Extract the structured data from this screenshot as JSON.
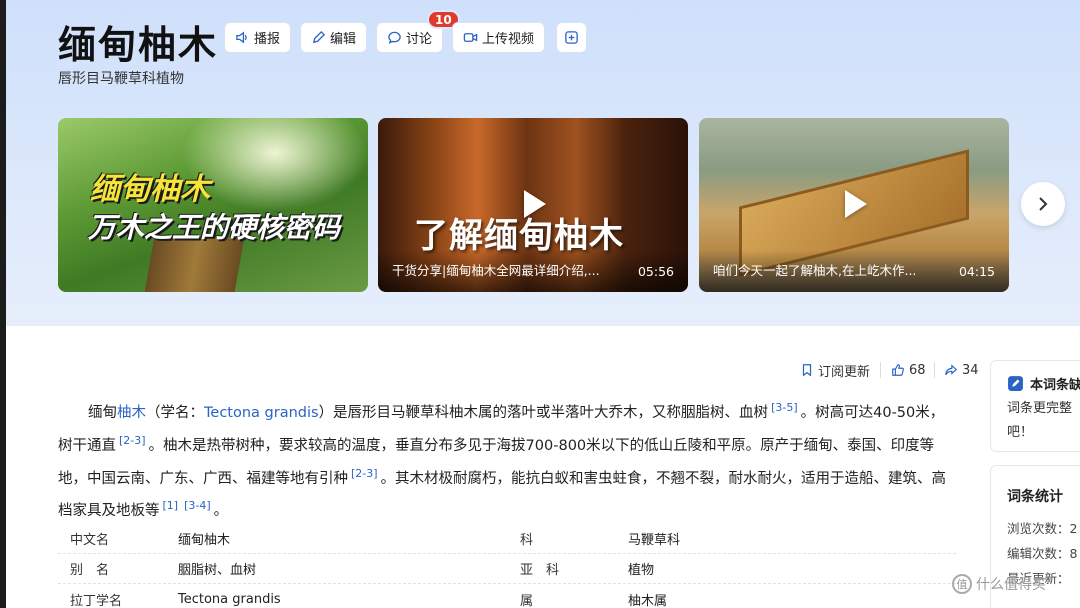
{
  "header": {
    "title": "缅甸柚木",
    "subtitle": "唇形目马鞭草科植物",
    "actions": {
      "broadcast": "播报",
      "edit": "编辑",
      "discuss": "讨论",
      "discuss_count": "10",
      "upload_video": "上传视频"
    }
  },
  "videos": [
    {
      "overlay_line1": "缅甸柚木",
      "overlay_line2": "万木之王的硬核密码"
    },
    {
      "overlay": "了解缅甸柚木",
      "caption": "干货分享|缅甸柚木全网最详细介绍,...",
      "duration": "05:56"
    },
    {
      "caption": "咱们今天一起了解柚木,在上屹木作...",
      "duration": "04:15"
    }
  ],
  "meta": {
    "subscribe": "订阅更新",
    "likes": "68",
    "shares": "34"
  },
  "intro": {
    "p1": "缅甸",
    "link1": "柚木",
    "p2": "（学名：",
    "link2": "Tectona grandis",
    "p3": "）是唇形目马鞭草科柚木属的落叶或半落叶大乔木，又称胭脂树、血树",
    "ref1": "[3-5]",
    "p4": "。树高可达40-50米，树干通直",
    "ref2": "[2-3]",
    "p5": "。柚木是热带树种，要求较高的温度，垂直分布多见于海拔700-800米以下的低山丘陵和平原。原产于缅甸、泰国、印度等地，中国云南、广东、广西、福建等地有引种",
    "ref3": "[2-3]",
    "p6": "。其木材极耐腐朽，能抗白蚁和害虫蛀食，不翘不裂，耐水耐火，适用于造船、建筑、高档家具及地板等",
    "ref4": "[1]",
    "ref5": "[3-4]",
    "p7": "。"
  },
  "info_table": [
    {
      "k1": "中文名",
      "v1": "缅甸柚木",
      "k2": "科",
      "v2": "马鞭草科"
    },
    {
      "k1": "别　名",
      "v1": "胭脂树、血树",
      "k2": "亚　科",
      "v2": "植物"
    },
    {
      "k1": "拉丁学名",
      "v1": "Tectona grandis",
      "k2": "属",
      "v2": "柚木属"
    }
  ],
  "sidebar": {
    "card1_title": "本词条缺",
    "card1_line1": "词条更完整",
    "card1_line2": "吧！",
    "stats_title": "词条统计",
    "stat1": "浏览次数：2",
    "stat2": "编辑次数：8",
    "stat3": "最近更新："
  },
  "watermark": "什么值得买",
  "colors": {
    "link": "#2a63c4",
    "badge": "#e03a2f",
    "hero_bg": "#d6e4fb"
  }
}
